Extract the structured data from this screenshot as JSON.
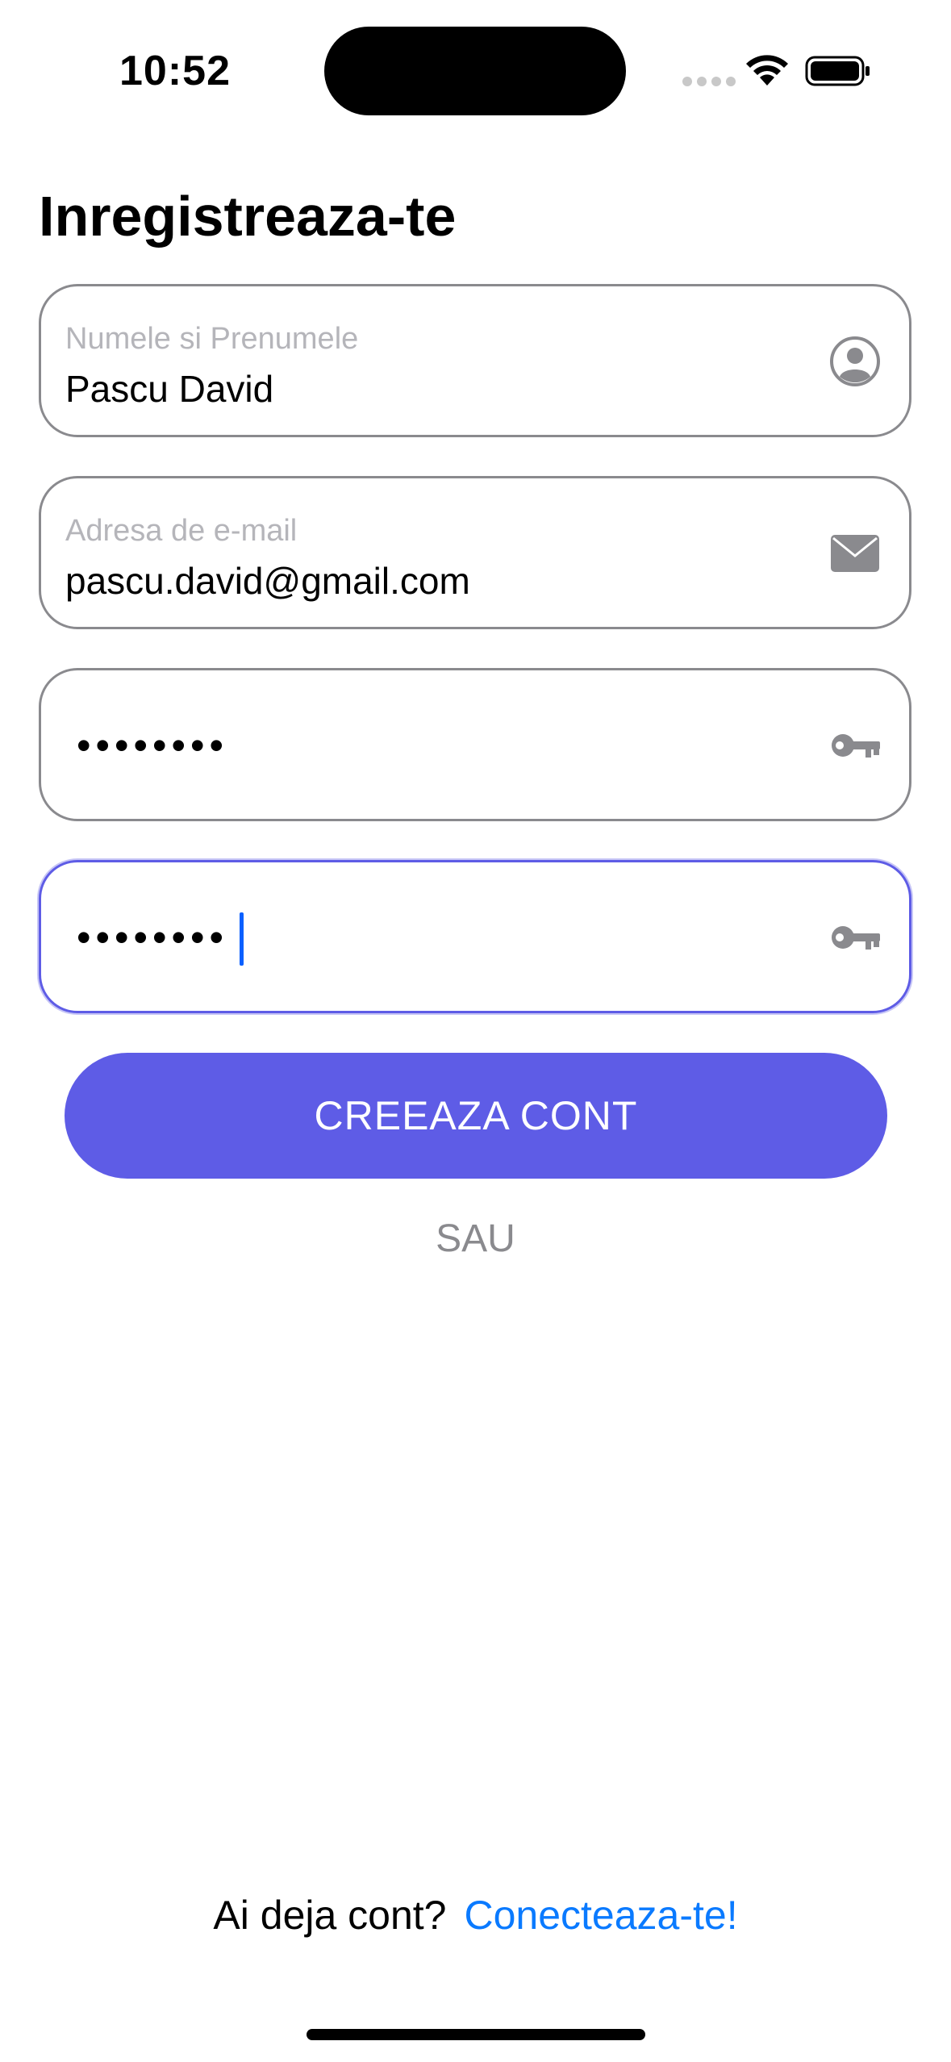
{
  "status_bar": {
    "time": "10:52"
  },
  "page": {
    "title": "Inregistreaza-te"
  },
  "form": {
    "name_field": {
      "label": "Numele si Prenumele",
      "value": "Pascu David",
      "icon": "person-circle-icon"
    },
    "email_field": {
      "label": "Adresa de e-mail",
      "value": "pascu.david@gmail.com",
      "icon": "envelope-icon"
    },
    "password_field": {
      "masked_value": "••••••••",
      "icon": "key-icon"
    },
    "confirm_password_field": {
      "masked_value": "••••••••",
      "icon": "key-icon",
      "focused": true
    },
    "submit_label": "CREEAZA CONT",
    "separator_label": "SAU"
  },
  "footer": {
    "prompt": "Ai deja cont?",
    "link_label": "Conecteaza-te!"
  },
  "colors": {
    "accent": "#5e5ce6",
    "link": "#0a7aff",
    "border": "#8a8a8e",
    "placeholder": "#b5b5ba"
  }
}
